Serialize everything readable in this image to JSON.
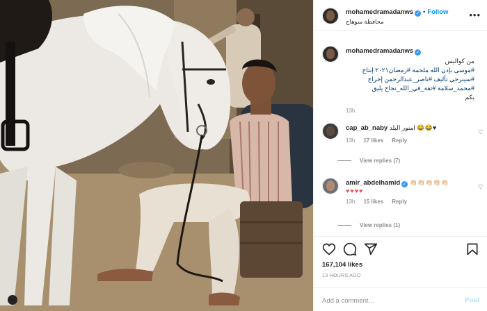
{
  "post": {
    "username": "mohamedramadanws",
    "verified": true,
    "follow_label": "Follow",
    "location": "محافظة سوهاج",
    "more_label": "•••"
  },
  "caption": {
    "username": "mohamedramadanws",
    "line1_plain": "من كواليس",
    "line1_tags": "#موسى بإذن الله ملحمة #رمضان٢٠٢١ إنتاج",
    "line2": "#سينرجي تأليف #ناصر_عبدالرحمن إخراج",
    "line3": "#محمد_سلامة #ثقة_في_الله_نجاح يليق",
    "line4": "بكم",
    "time": "13h"
  },
  "comments": [
    {
      "username": "cap_ab_naby",
      "verified": false,
      "text": "امنور البلد 😂😂♥",
      "time": "13h",
      "likes": "17 likes",
      "reply": "Reply",
      "view_replies": "View replies (7)"
    },
    {
      "username": "amir_abdelhamid",
      "verified": true,
      "text": "👏🏻👏🏻👏🏻👏🏻👏🏻",
      "hearts": "♥♥♥♥",
      "time": "13h",
      "likes": "15 likes",
      "reply": "Reply",
      "view_replies": "View replies (1)"
    }
  ],
  "actions": {
    "likes": "167,104 likes",
    "timestamp": "13 HOURS AGO",
    "comment_placeholder": "Add a comment…",
    "post_label": "Post",
    "icons": [
      "heart-icon",
      "comment-icon",
      "share-icon",
      "bookmark-icon"
    ]
  },
  "colors": {
    "link_blue": "#0095f6",
    "hashtag": "#00376b",
    "muted": "#8e8e8e",
    "heart_red": "#ed4956",
    "post_disabled": "#b2dffc"
  }
}
